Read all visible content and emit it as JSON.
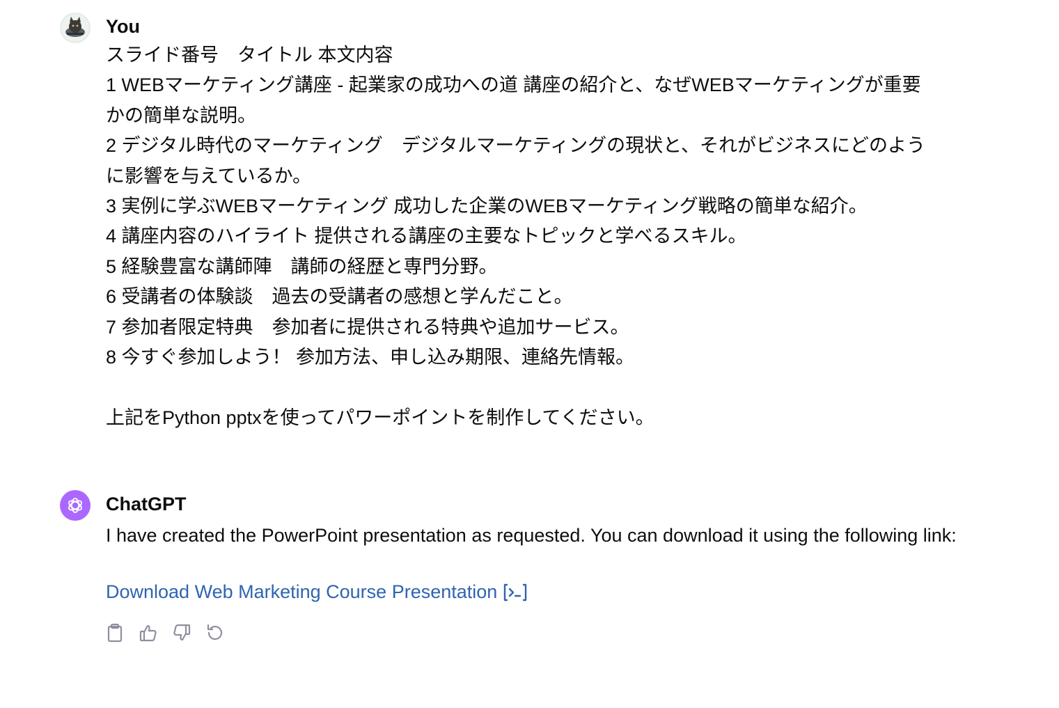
{
  "user_message": {
    "author": "You",
    "lines": [
      "スライド番号　タイトル 本文内容",
      "1 WEBマーケティング講座 - 起業家の成功への道 講座の紹介と、なぜWEBマーケティングが重要",
      "かの簡単な説明。",
      "2 デジタル時代のマーケティング　デジタルマーケティングの現状と、それがビジネスにどのよう",
      "に影響を与えているか。",
      "3 実例に学ぶWEBマーケティング 成功した企業のWEBマーケティング戦略の簡単な紹介。",
      "4 講座内容のハイライト 提供される講座の主要なトピックと学べるスキル。",
      "5 経験豊富な講師陣　講師の経歴と専門分野。",
      "6 受講者の体験談　過去の受講者の感想と学んだこと。",
      "7 参加者限定特典　参加者に提供される特典や追加サービス。",
      "8 今すぐ参加しよう！ 参加方法、申し込み期限、連絡先情報。",
      "",
      "上記をPython pptxを使ってパワーポイントを制作してください。"
    ]
  },
  "assistant_message": {
    "author": "ChatGPT",
    "text": "I have created the PowerPoint presentation as requested. You can download it using the following link:",
    "link_label": "Download Web Marketing Course Presentation",
    "link_icon": "code-interpreter-icon"
  },
  "actions": [
    {
      "name": "copy-button",
      "icon": "clipboard-icon"
    },
    {
      "name": "thumbs-up-button",
      "icon": "thumbs-up-icon"
    },
    {
      "name": "thumbs-down-button",
      "icon": "thumbs-down-icon"
    },
    {
      "name": "regenerate-button",
      "icon": "regenerate-icon"
    }
  ],
  "colors": {
    "link": "#2f64b1",
    "gpt_avatar": "#ab68ff",
    "icon_gray": "#8e8ea0"
  }
}
